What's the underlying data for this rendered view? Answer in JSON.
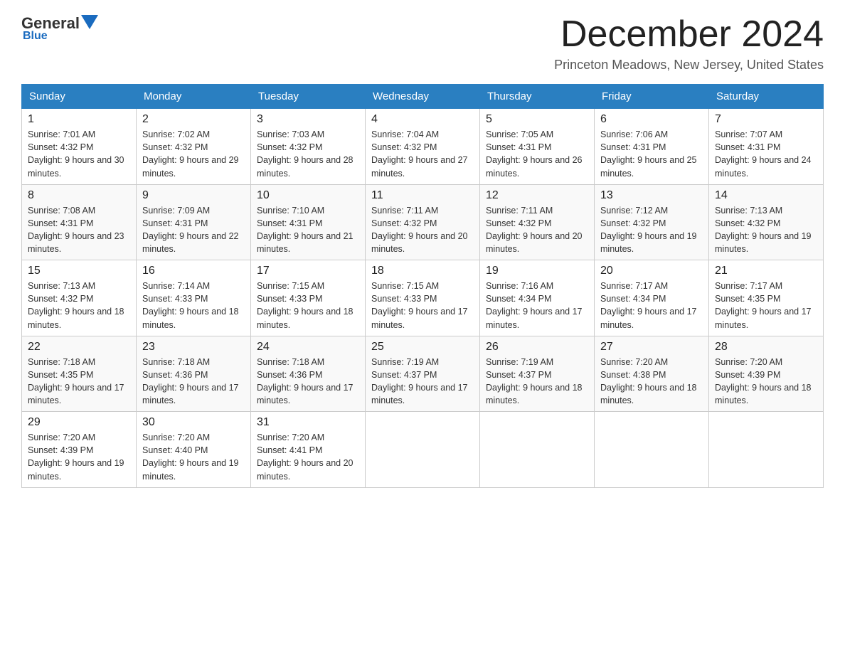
{
  "header": {
    "logo": {
      "part1": "General",
      "triangle": "",
      "part2": "Blue",
      "underline": "Blue"
    },
    "title": "December 2024",
    "subtitle": "Princeton Meadows, New Jersey, United States"
  },
  "calendar": {
    "days_of_week": [
      "Sunday",
      "Monday",
      "Tuesday",
      "Wednesday",
      "Thursday",
      "Friday",
      "Saturday"
    ],
    "weeks": [
      [
        {
          "day": "1",
          "sunrise": "7:01 AM",
          "sunset": "4:32 PM",
          "daylight": "9 hours and 30 minutes."
        },
        {
          "day": "2",
          "sunrise": "7:02 AM",
          "sunset": "4:32 PM",
          "daylight": "9 hours and 29 minutes."
        },
        {
          "day": "3",
          "sunrise": "7:03 AM",
          "sunset": "4:32 PM",
          "daylight": "9 hours and 28 minutes."
        },
        {
          "day": "4",
          "sunrise": "7:04 AM",
          "sunset": "4:32 PM",
          "daylight": "9 hours and 27 minutes."
        },
        {
          "day": "5",
          "sunrise": "7:05 AM",
          "sunset": "4:31 PM",
          "daylight": "9 hours and 26 minutes."
        },
        {
          "day": "6",
          "sunrise": "7:06 AM",
          "sunset": "4:31 PM",
          "daylight": "9 hours and 25 minutes."
        },
        {
          "day": "7",
          "sunrise": "7:07 AM",
          "sunset": "4:31 PM",
          "daylight": "9 hours and 24 minutes."
        }
      ],
      [
        {
          "day": "8",
          "sunrise": "7:08 AM",
          "sunset": "4:31 PM",
          "daylight": "9 hours and 23 minutes."
        },
        {
          "day": "9",
          "sunrise": "7:09 AM",
          "sunset": "4:31 PM",
          "daylight": "9 hours and 22 minutes."
        },
        {
          "day": "10",
          "sunrise": "7:10 AM",
          "sunset": "4:31 PM",
          "daylight": "9 hours and 21 minutes."
        },
        {
          "day": "11",
          "sunrise": "7:11 AM",
          "sunset": "4:32 PM",
          "daylight": "9 hours and 20 minutes."
        },
        {
          "day": "12",
          "sunrise": "7:11 AM",
          "sunset": "4:32 PM",
          "daylight": "9 hours and 20 minutes."
        },
        {
          "day": "13",
          "sunrise": "7:12 AM",
          "sunset": "4:32 PM",
          "daylight": "9 hours and 19 minutes."
        },
        {
          "day": "14",
          "sunrise": "7:13 AM",
          "sunset": "4:32 PM",
          "daylight": "9 hours and 19 minutes."
        }
      ],
      [
        {
          "day": "15",
          "sunrise": "7:13 AM",
          "sunset": "4:32 PM",
          "daylight": "9 hours and 18 minutes."
        },
        {
          "day": "16",
          "sunrise": "7:14 AM",
          "sunset": "4:33 PM",
          "daylight": "9 hours and 18 minutes."
        },
        {
          "day": "17",
          "sunrise": "7:15 AM",
          "sunset": "4:33 PM",
          "daylight": "9 hours and 18 minutes."
        },
        {
          "day": "18",
          "sunrise": "7:15 AM",
          "sunset": "4:33 PM",
          "daylight": "9 hours and 17 minutes."
        },
        {
          "day": "19",
          "sunrise": "7:16 AM",
          "sunset": "4:34 PM",
          "daylight": "9 hours and 17 minutes."
        },
        {
          "day": "20",
          "sunrise": "7:17 AM",
          "sunset": "4:34 PM",
          "daylight": "9 hours and 17 minutes."
        },
        {
          "day": "21",
          "sunrise": "7:17 AM",
          "sunset": "4:35 PM",
          "daylight": "9 hours and 17 minutes."
        }
      ],
      [
        {
          "day": "22",
          "sunrise": "7:18 AM",
          "sunset": "4:35 PM",
          "daylight": "9 hours and 17 minutes."
        },
        {
          "day": "23",
          "sunrise": "7:18 AM",
          "sunset": "4:36 PM",
          "daylight": "9 hours and 17 minutes."
        },
        {
          "day": "24",
          "sunrise": "7:18 AM",
          "sunset": "4:36 PM",
          "daylight": "9 hours and 17 minutes."
        },
        {
          "day": "25",
          "sunrise": "7:19 AM",
          "sunset": "4:37 PM",
          "daylight": "9 hours and 17 minutes."
        },
        {
          "day": "26",
          "sunrise": "7:19 AM",
          "sunset": "4:37 PM",
          "daylight": "9 hours and 18 minutes."
        },
        {
          "day": "27",
          "sunrise": "7:20 AM",
          "sunset": "4:38 PM",
          "daylight": "9 hours and 18 minutes."
        },
        {
          "day": "28",
          "sunrise": "7:20 AM",
          "sunset": "4:39 PM",
          "daylight": "9 hours and 18 minutes."
        }
      ],
      [
        {
          "day": "29",
          "sunrise": "7:20 AM",
          "sunset": "4:39 PM",
          "daylight": "9 hours and 19 minutes."
        },
        {
          "day": "30",
          "sunrise": "7:20 AM",
          "sunset": "4:40 PM",
          "daylight": "9 hours and 19 minutes."
        },
        {
          "day": "31",
          "sunrise": "7:20 AM",
          "sunset": "4:41 PM",
          "daylight": "9 hours and 20 minutes."
        },
        null,
        null,
        null,
        null
      ]
    ]
  }
}
